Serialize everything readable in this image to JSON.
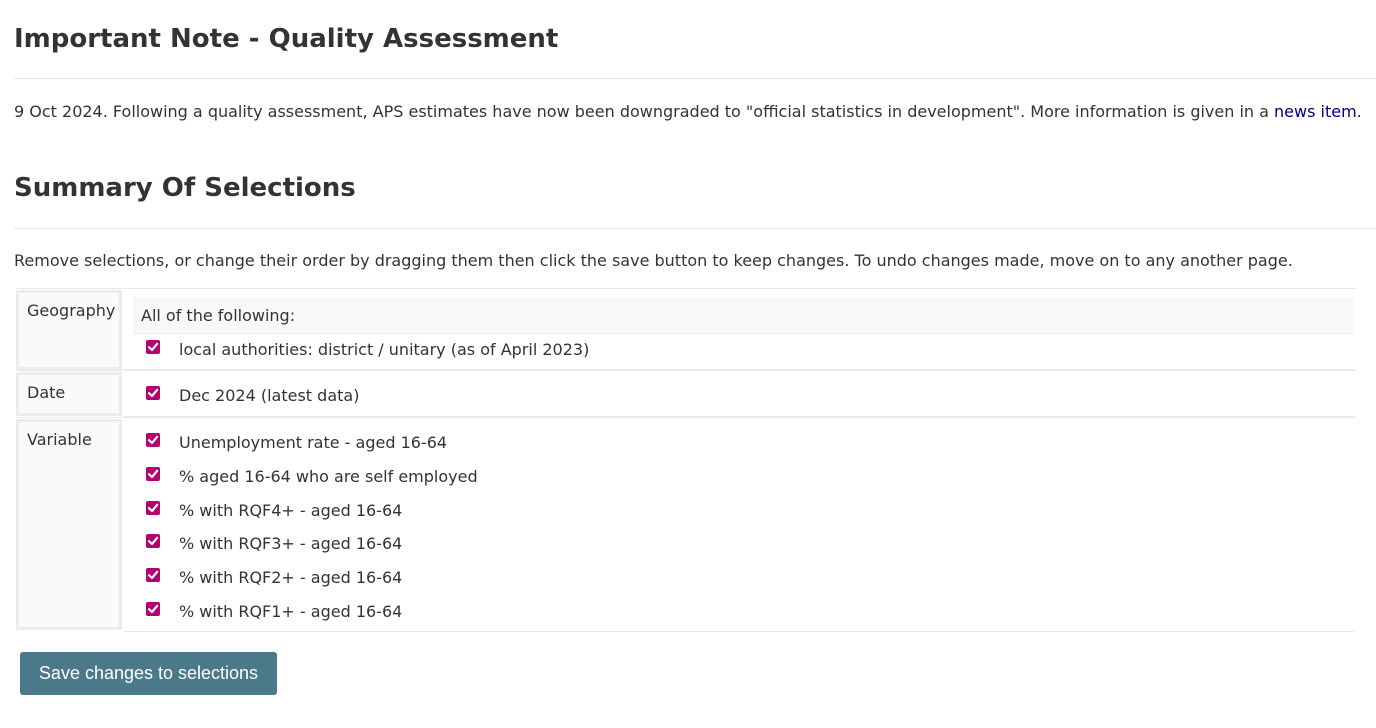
{
  "note": {
    "title": "Important Note - Quality Assessment",
    "text": "9 Oct 2024. Following a quality assessment, APS estimates have now been downgraded to \"official statistics in development\". More information is given in a ",
    "link_text": "news item",
    "text_end": "."
  },
  "summary": {
    "title": "Summary Of Selections",
    "instructions": "Remove selections, or change their order by dragging them then click the save button to keep changes. To undo changes made, move on to any another page."
  },
  "selections": {
    "geography": {
      "label": "Geography",
      "group_header": "All of the following:",
      "items": [
        "local authorities: district / unitary (as of April 2023)"
      ]
    },
    "date": {
      "label": "Date",
      "items": [
        "Dec 2024 (latest data)"
      ]
    },
    "variable": {
      "label": "Variable",
      "items": [
        "Unemployment rate - aged 16-64",
        "% aged 16-64 who are self employed",
        "% with RQF4+ - aged 16-64",
        "% with RQF3+ - aged 16-64",
        "% with RQF2+ - aged 16-64",
        "% with RQF1+ - aged 16-64"
      ]
    }
  },
  "save_button": {
    "label": "Save changes to selections"
  },
  "colors": {
    "checkbox": "#b5006f",
    "button": "#4a7a8a",
    "link": "#000080"
  }
}
